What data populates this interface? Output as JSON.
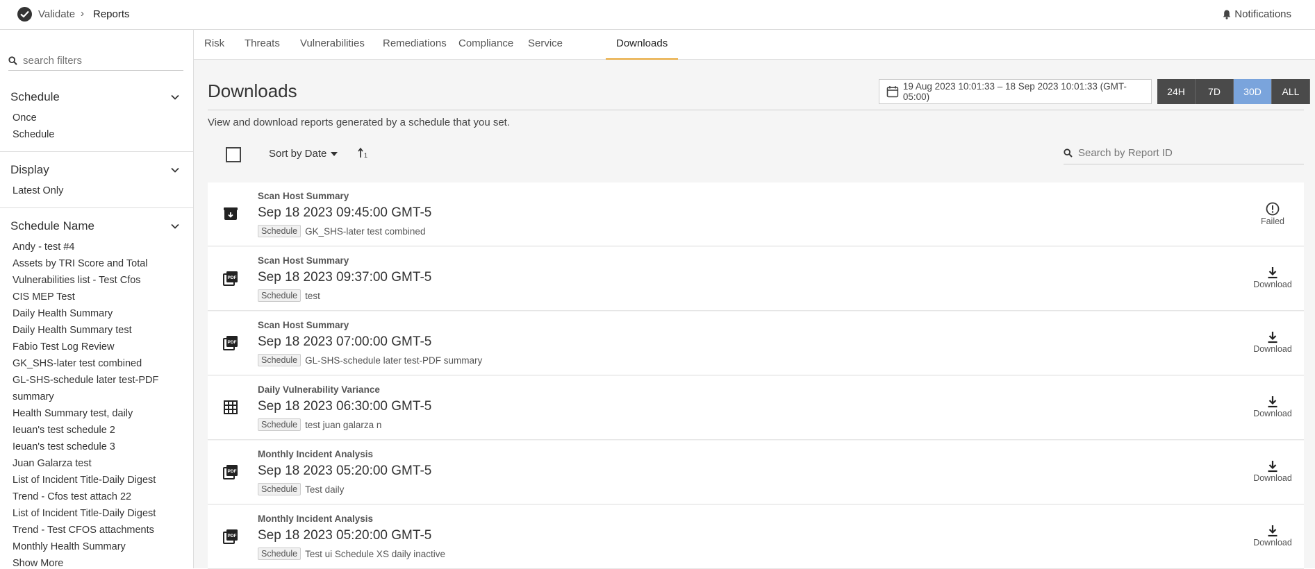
{
  "header": {
    "breadcrumb_root": "Validate",
    "breadcrumb_separator": "›",
    "breadcrumb_current": "Reports",
    "notifications_label": "Notifications"
  },
  "sidebar": {
    "search_placeholder": "search filters",
    "schedule": {
      "title": "Schedule",
      "items": [
        "Once",
        "Schedule"
      ]
    },
    "display": {
      "title": "Display",
      "items": [
        "Latest Only"
      ]
    },
    "schedule_name": {
      "title": "Schedule Name",
      "items": [
        "Andy - test #4",
        "Assets by TRI Score and Total",
        "Vulnerabilities list - Test Cfos",
        "CIS MEP Test",
        "Daily Health Summary",
        "Daily Health Summary test",
        "Fabio Test Log Review",
        "GK_SHS-later test combined",
        "GL-SHS-schedule later test-PDF",
        "summary",
        "Health Summary test, daily",
        "Ieuan's test schedule 2",
        "Ieuan's test schedule 3",
        "Juan Galarza test",
        "List of Incident Title-Daily Digest",
        "Trend - Cfos test attach 22",
        "List of Incident Title-Daily Digest",
        "Trend - Test CFOS attachments",
        "Monthly Health Summary"
      ],
      "show_more": "Show More"
    }
  },
  "tabs": [
    {
      "label": "Risk",
      "active": false
    },
    {
      "label": "Threats",
      "active": false
    },
    {
      "label": "Vulnerabilities",
      "active": false
    },
    {
      "label": "Remediations",
      "active": false
    },
    {
      "label": "Compliance",
      "active": false
    },
    {
      "label": "Service",
      "active": false
    },
    {
      "label": "Downloads",
      "active": true
    }
  ],
  "main": {
    "title": "Downloads",
    "date_range": "19 Aug 2023 10:01:33 – 18 Sep 2023 10:01:33 (GMT-05:00)",
    "range_buttons": [
      {
        "label": "24H",
        "active": false
      },
      {
        "label": "7D",
        "active": false
      },
      {
        "label": "30D",
        "active": true
      },
      {
        "label": "ALL",
        "active": false
      }
    ],
    "subtitle": "View and download reports generated by a schedule that you set.",
    "sort_label": "Sort by Date",
    "report_search_placeholder": "Search by Report ID"
  },
  "reports": [
    {
      "icon": "archive-icon",
      "type": "Scan Host Summary",
      "time": "Sep 18 2023 09:45:00 GMT-5",
      "tag": "Schedule",
      "schedule": "GK_SHS-later test combined",
      "status": "Failed"
    },
    {
      "icon": "pdf-icon",
      "type": "Scan Host Summary",
      "time": "Sep 18 2023 09:37:00 GMT-5",
      "tag": "Schedule",
      "schedule": "test",
      "status": "Download"
    },
    {
      "icon": "pdf-icon",
      "type": "Scan Host Summary",
      "time": "Sep 18 2023 07:00:00 GMT-5",
      "tag": "Schedule",
      "schedule": "GL-SHS-schedule later test-PDF summary",
      "status": "Download"
    },
    {
      "icon": "table-icon",
      "type": "Daily Vulnerability Variance",
      "time": "Sep 18 2023 06:30:00 GMT-5",
      "tag": "Schedule",
      "schedule": "test juan galarza n",
      "status": "Download"
    },
    {
      "icon": "pdf-icon",
      "type": "Monthly Incident Analysis",
      "time": "Sep 18 2023 05:20:00 GMT-5",
      "tag": "Schedule",
      "schedule": "Test daily",
      "status": "Download"
    },
    {
      "icon": "pdf-icon",
      "type": "Monthly Incident Analysis",
      "time": "Sep 18 2023 05:20:00 GMT-5",
      "tag": "Schedule",
      "schedule": "Test ui Schedule XS daily inactive",
      "status": "Download"
    }
  ],
  "colors": {
    "accent_tab": "#e8a83a",
    "active_range": "#7aa4dc",
    "range_bg": "#4a4a4a"
  }
}
